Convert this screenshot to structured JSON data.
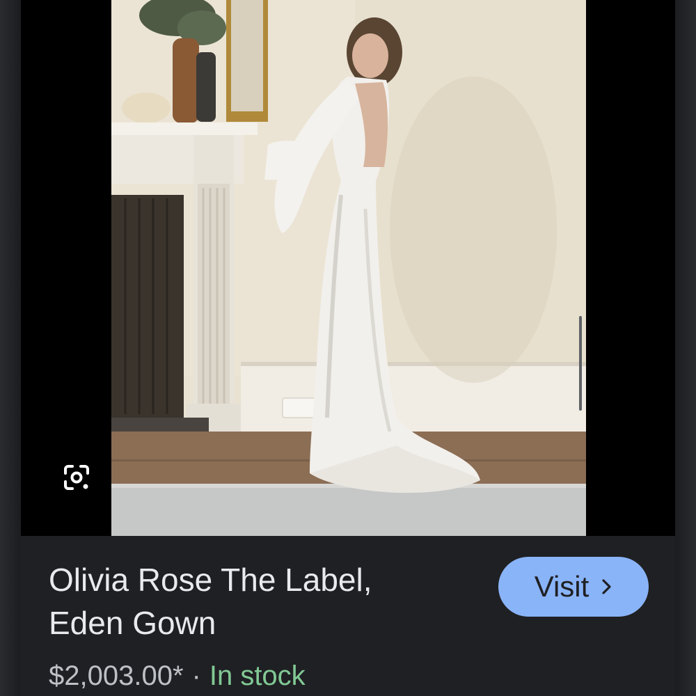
{
  "product": {
    "title_line1": "Olivia Rose The Label,",
    "title_line2": "Eden Gown",
    "price": "$2,003.00*",
    "separator": "·",
    "availability": "In stock"
  },
  "actions": {
    "visit_label": "Visit",
    "visit_icon": "chevron-right-icon",
    "lens_icon": "google-lens-icon"
  },
  "colors": {
    "background": "#1f2023",
    "visit_button": "#8ab4f8",
    "in_stock": "#81c995",
    "title_text": "#e8eaed"
  }
}
